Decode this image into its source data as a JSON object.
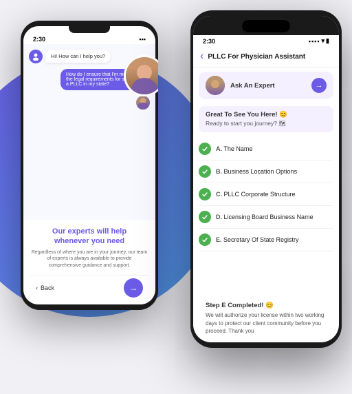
{
  "background": {
    "circle_gradient_start": "#6b5be6",
    "circle_gradient_end": "#4f9de8"
  },
  "left_phone": {
    "status_time": "2:30",
    "chat_bubble_1": "Hi! How can I help you?",
    "chat_bubble_2": "How do I ensure that I'm meeting all the legal requirements for setting up a PLLC in my state?",
    "experts_headline_1": "Our experts will help",
    "experts_headline_2": "whenever you need",
    "experts_sub": "Regardless of where you are in your journey, our team of experts is always available to provide comprehensive guidance and support.",
    "back_label": "Back",
    "nav_arrow": "→"
  },
  "right_phone": {
    "status_time": "2:30",
    "header_title": "PLLC For Physician Assistant",
    "back_chevron": "‹",
    "expert_label": "Ask An Expert",
    "expert_arrow": "→",
    "welcome_title": "Great To See You Here! 😊",
    "welcome_sub": "Ready to start you journey? 🗺",
    "checklist": [
      {
        "letter": "A.",
        "label": "The Name"
      },
      {
        "letter": "B.",
        "label": "Business Location Options"
      },
      {
        "letter": "C.",
        "label": "PLLC Corporate Structure"
      },
      {
        "letter": "D.",
        "label": "Licensing Board Business Name"
      },
      {
        "letter": "E.",
        "label": "Secretary Of State Registry"
      }
    ],
    "step_completed_title": "Step E Completed! 😊",
    "step_completed_text": "We will authorize your license within two working days to protect our client community before you proceed. Thank you"
  }
}
